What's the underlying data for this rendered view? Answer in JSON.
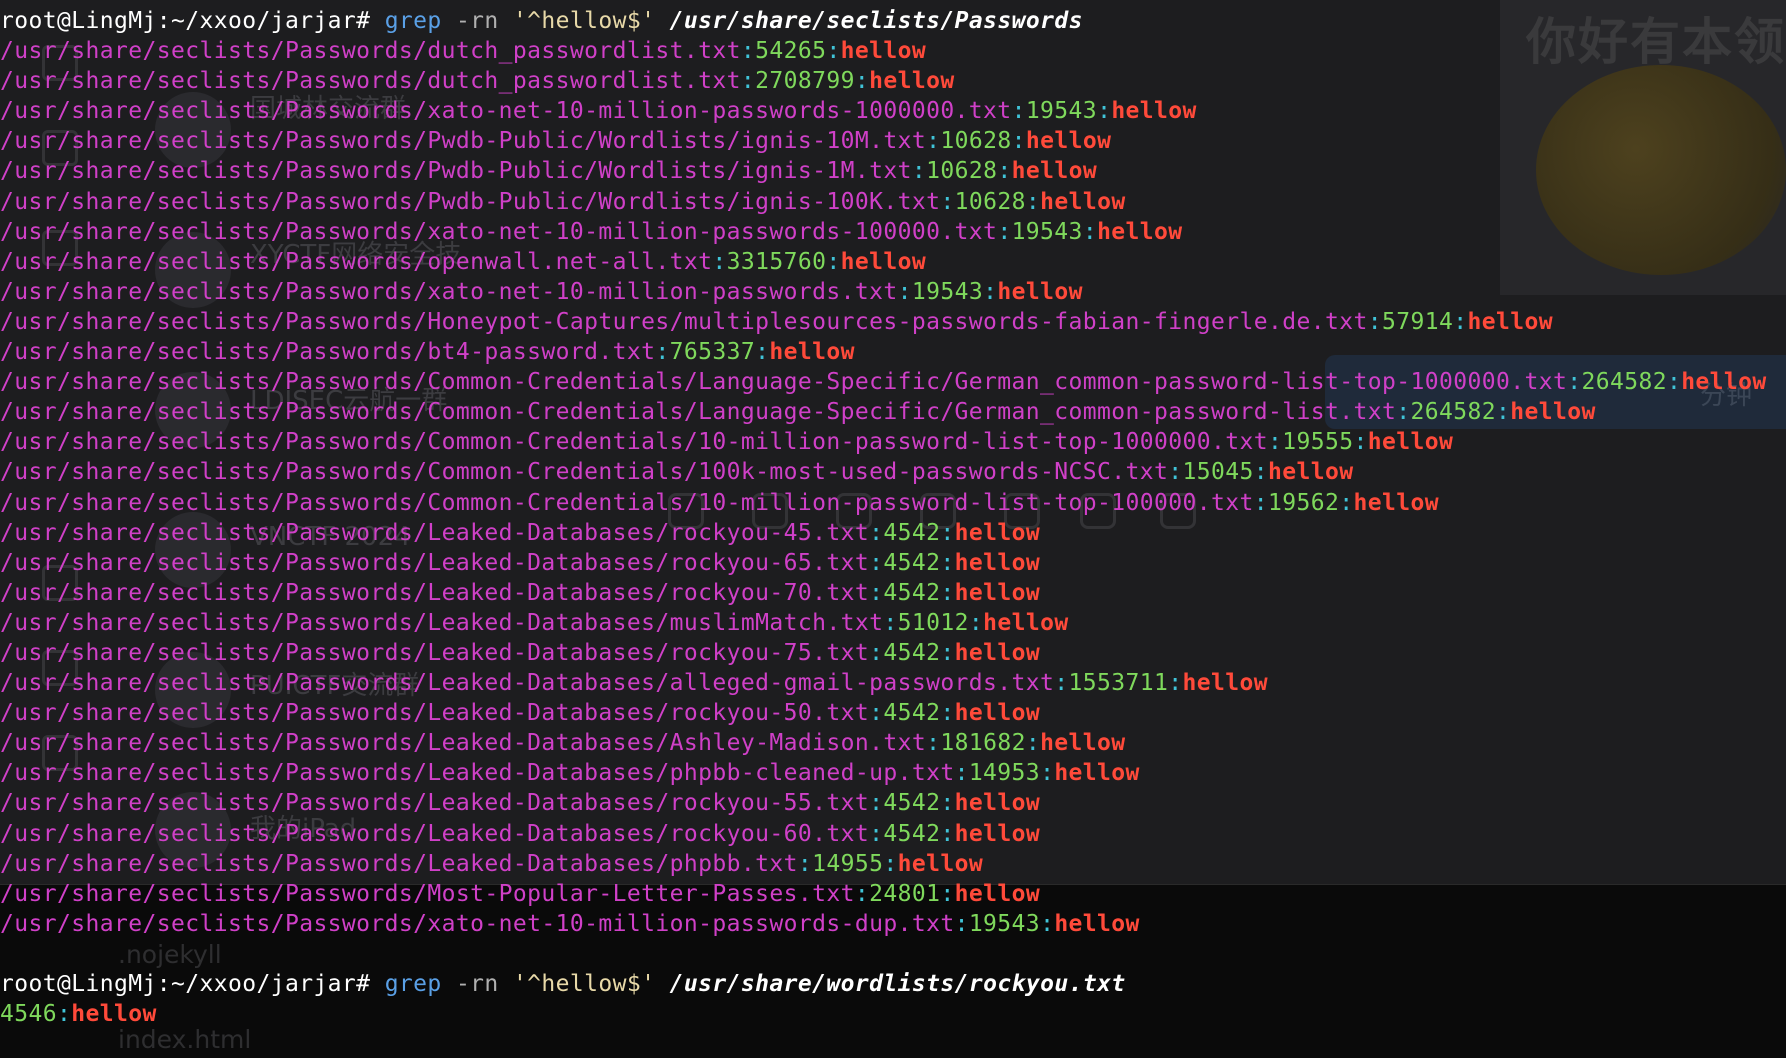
{
  "terminal": {
    "prompt": "root@LingMj:~/xxoo/jarjar#",
    "commands": [
      {
        "tool": "grep",
        "flags": "-rn",
        "pattern": "'^hellow$'",
        "path": "/usr/share/seclists/Passwords",
        "results": [
          {
            "file": "/usr/share/seclists/Passwords/dutch_passwordlist.txt",
            "line": "54265",
            "match": "hellow"
          },
          {
            "file": "/usr/share/seclists/Passwords/dutch_passwordlist.txt",
            "line": "2708799",
            "match": "hellow"
          },
          {
            "file": "/usr/share/seclists/Passwords/xato-net-10-million-passwords-1000000.txt",
            "line": "19543",
            "match": "hellow"
          },
          {
            "file": "/usr/share/seclists/Passwords/Pwdb-Public/Wordlists/ignis-10M.txt",
            "line": "10628",
            "match": "hellow"
          },
          {
            "file": "/usr/share/seclists/Passwords/Pwdb-Public/Wordlists/ignis-1M.txt",
            "line": "10628",
            "match": "hellow"
          },
          {
            "file": "/usr/share/seclists/Passwords/Pwdb-Public/Wordlists/ignis-100K.txt",
            "line": "10628",
            "match": "hellow"
          },
          {
            "file": "/usr/share/seclists/Passwords/xato-net-10-million-passwords-100000.txt",
            "line": "19543",
            "match": "hellow"
          },
          {
            "file": "/usr/share/seclists/Passwords/openwall.net-all.txt",
            "line": "3315760",
            "match": "hellow"
          },
          {
            "file": "/usr/share/seclists/Passwords/xato-net-10-million-passwords.txt",
            "line": "19543",
            "match": "hellow"
          },
          {
            "file": "/usr/share/seclists/Passwords/Honeypot-Captures/multiplesources-passwords-fabian-fingerle.de.txt",
            "line": "57914",
            "match": "hellow"
          },
          {
            "file": "/usr/share/seclists/Passwords/bt4-password.txt",
            "line": "765337",
            "match": "hellow"
          },
          {
            "file": "/usr/share/seclists/Passwords/Common-Credentials/Language-Specific/German_common-password-list-top-1000000.txt",
            "line": "264582",
            "match": "hellow"
          },
          {
            "file": "/usr/share/seclists/Passwords/Common-Credentials/Language-Specific/German_common-password-list.txt",
            "line": "264582",
            "match": "hellow"
          },
          {
            "file": "/usr/share/seclists/Passwords/Common-Credentials/10-million-password-list-top-1000000.txt",
            "line": "19555",
            "match": "hellow"
          },
          {
            "file": "/usr/share/seclists/Passwords/Common-Credentials/100k-most-used-passwords-NCSC.txt",
            "line": "15045",
            "match": "hellow"
          },
          {
            "file": "/usr/share/seclists/Passwords/Common-Credentials/10-million-password-list-top-100000.txt",
            "line": "19562",
            "match": "hellow"
          },
          {
            "file": "/usr/share/seclists/Passwords/Leaked-Databases/rockyou-45.txt",
            "line": "4542",
            "match": "hellow"
          },
          {
            "file": "/usr/share/seclists/Passwords/Leaked-Databases/rockyou-65.txt",
            "line": "4542",
            "match": "hellow"
          },
          {
            "file": "/usr/share/seclists/Passwords/Leaked-Databases/rockyou-70.txt",
            "line": "4542",
            "match": "hellow"
          },
          {
            "file": "/usr/share/seclists/Passwords/Leaked-Databases/muslimMatch.txt",
            "line": "51012",
            "match": "hellow"
          },
          {
            "file": "/usr/share/seclists/Passwords/Leaked-Databases/rockyou-75.txt",
            "line": "4542",
            "match": "hellow"
          },
          {
            "file": "/usr/share/seclists/Passwords/Leaked-Databases/alleged-gmail-passwords.txt",
            "line": "1553711",
            "match": "hellow"
          },
          {
            "file": "/usr/share/seclists/Passwords/Leaked-Databases/rockyou-50.txt",
            "line": "4542",
            "match": "hellow"
          },
          {
            "file": "/usr/share/seclists/Passwords/Leaked-Databases/Ashley-Madison.txt",
            "line": "181682",
            "match": "hellow"
          },
          {
            "file": "/usr/share/seclists/Passwords/Leaked-Databases/phpbb-cleaned-up.txt",
            "line": "14953",
            "match": "hellow"
          },
          {
            "file": "/usr/share/seclists/Passwords/Leaked-Databases/rockyou-55.txt",
            "line": "4542",
            "match": "hellow"
          },
          {
            "file": "/usr/share/seclists/Passwords/Leaked-Databases/rockyou-60.txt",
            "line": "4542",
            "match": "hellow"
          },
          {
            "file": "/usr/share/seclists/Passwords/Leaked-Databases/phpbb.txt",
            "line": "14955",
            "match": "hellow"
          },
          {
            "file": "/usr/share/seclists/Passwords/Most-Popular-Letter-Passes.txt",
            "line": "24801",
            "match": "hellow"
          },
          {
            "file": "/usr/share/seclists/Passwords/xato-net-10-million-passwords-dup.txt",
            "line": "19543",
            "match": "hellow"
          }
        ]
      },
      {
        "tool": "grep",
        "flags": "-rn",
        "pattern": "'^hellow$'",
        "path": "/usr/share/wordlists/rockyou.txt",
        "results": [
          {
            "file": "",
            "line": "4546",
            "match": "hellow"
          }
        ]
      }
    ]
  },
  "background_app": {
    "sticker_caption": "你好有本领",
    "bubble_text": "分钟",
    "chat_names": [
      "国城林交流群",
      "XYCTF网络安全技...",
      "LDISEC云航一群 ...",
      "VNCTF 2024",
      "PUICTF交流群",
      "我的iPad"
    ],
    "files": [
      ".nojekyll",
      "index.html"
    ]
  },
  "colors": {
    "terminal_bg": "#0a0a0a",
    "filename": "#d040c8",
    "separator": "#40c4d8",
    "line_number": "#7fd95c",
    "match": "#ff4a3a",
    "command": "#5aa0e6"
  }
}
